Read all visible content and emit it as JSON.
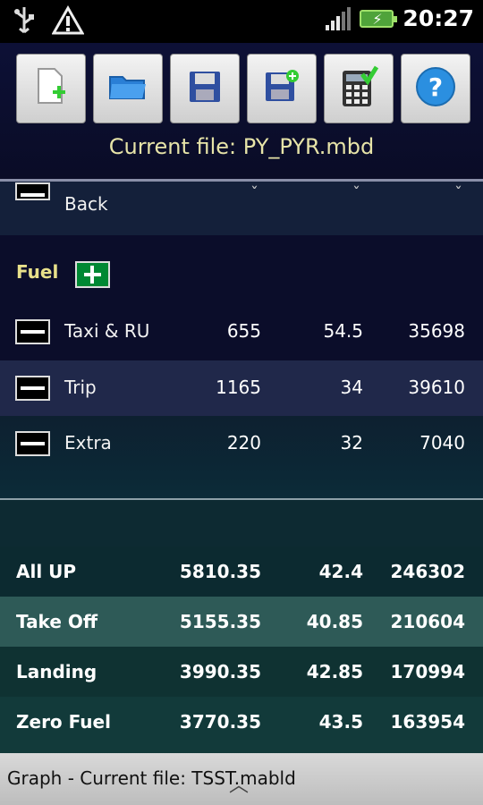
{
  "status": {
    "time": "20:27"
  },
  "toolbar": {
    "buttons": [
      "new-file",
      "open-folder",
      "save",
      "save-as",
      "calculator",
      "help"
    ]
  },
  "header": {
    "current_file": "Current file: PY_PYR.mbd"
  },
  "sections": {
    "back": {
      "label": "Back"
    },
    "fuel": {
      "title": "Fuel"
    }
  },
  "fuel_rows": [
    {
      "label": "Taxi & RU",
      "v1": "655",
      "v2": "54.5",
      "v3": "35698"
    },
    {
      "label": "Trip",
      "v1": "1165",
      "v2": "34",
      "v3": "39610"
    },
    {
      "label": "Extra",
      "v1": "220",
      "v2": "32",
      "v3": "7040"
    }
  ],
  "summary_rows": [
    {
      "label": "All UP",
      "v1": "5810.35",
      "v2": "42.4",
      "v3": "246302"
    },
    {
      "label": "Take Off",
      "v1": "5155.35",
      "v2": "40.85",
      "v3": "210604"
    },
    {
      "label": "Landing",
      "v1": "3990.35",
      "v2": "42.85",
      "v3": "170994"
    },
    {
      "label": "Zero Fuel",
      "v1": "3770.35",
      "v2": "43.5",
      "v3": "163954"
    }
  ],
  "bottom": {
    "text": "Graph  -  Current file: TSST.mabld"
  },
  "colors": {
    "accent": "#e7e4a8",
    "fuel_title": "#e8e08a"
  }
}
